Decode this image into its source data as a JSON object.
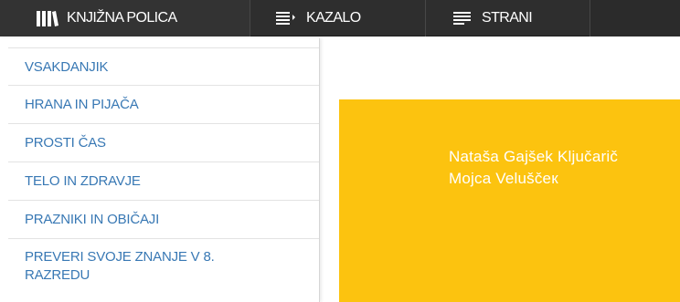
{
  "toolbar": {
    "bookshelf_label": "KNJIŽNA POLICA",
    "index_label": "KAZALO",
    "pages_label": "STRANI"
  },
  "menu": {
    "items": [
      {
        "label": "VSAKDANJIK"
      },
      {
        "label": "HRANA IN PIJAČA"
      },
      {
        "label": "PROSTI ČAS"
      },
      {
        "label": "TELO IN ZDRAVJE"
      },
      {
        "label": "PRAZNIKI IN OBIČAJI"
      },
      {
        "label": "PREVERI SVOJE ZNANJE V 8. RAZREDU"
      }
    ]
  },
  "cover": {
    "authors": [
      "Nataša Gajšek Ključarič",
      "Mojca Veluščeк"
    ]
  },
  "colors": {
    "toolbar_bg": "#2e2e2e",
    "menu_link": "#3878b4",
    "cover_bg": "#fcc30f"
  },
  "icons": {
    "bookshelf": "books-icon",
    "index": "list-arrow-icon",
    "pages": "text-lines-icon"
  }
}
